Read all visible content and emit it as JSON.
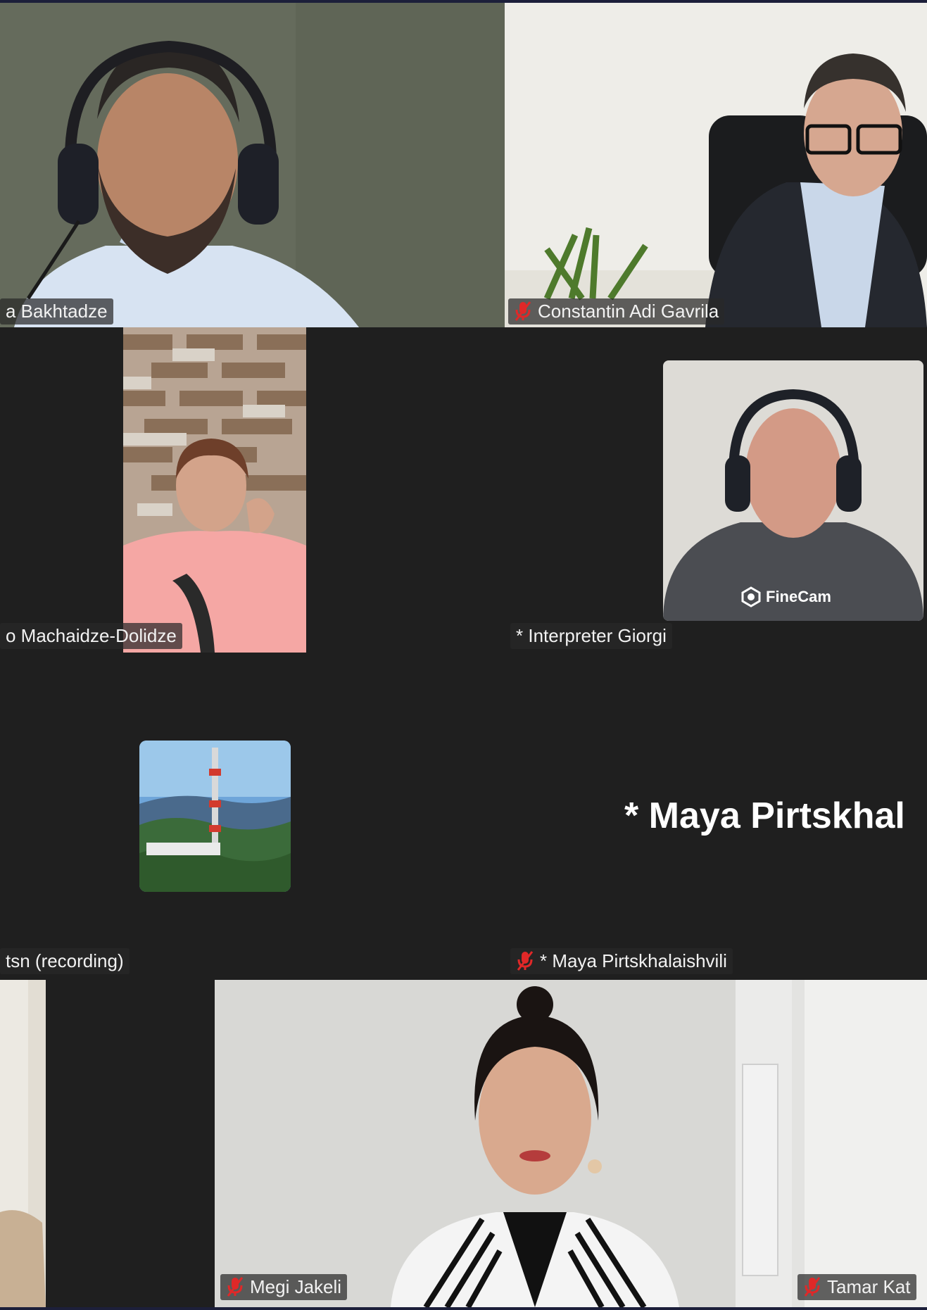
{
  "participants": {
    "p1": {
      "name": "a Bakhtadze",
      "muted": false
    },
    "p2": {
      "name": "Constantin Adi Gavrila",
      "muted": true
    },
    "p3": {
      "name": "o Machaidze-Dolidze",
      "muted": false
    },
    "p4": {
      "name": "* Interpreter Giorgi",
      "muted": false,
      "watermark": "FineCam"
    },
    "p5": {
      "name": "tsn (recording)",
      "muted": false
    },
    "p6": {
      "name": "* Maya Pirtskhalaishvili",
      "muted": true,
      "display_text": "* Maya Pirtskhal"
    },
    "p8": {
      "name": "Megi Jakeli",
      "muted": true
    },
    "p9": {
      "name": "Tamar Kat",
      "muted": true
    }
  },
  "colors": {
    "background": "#1f1f1f",
    "label_background": "#282828",
    "muted_icon": "#e02828"
  }
}
